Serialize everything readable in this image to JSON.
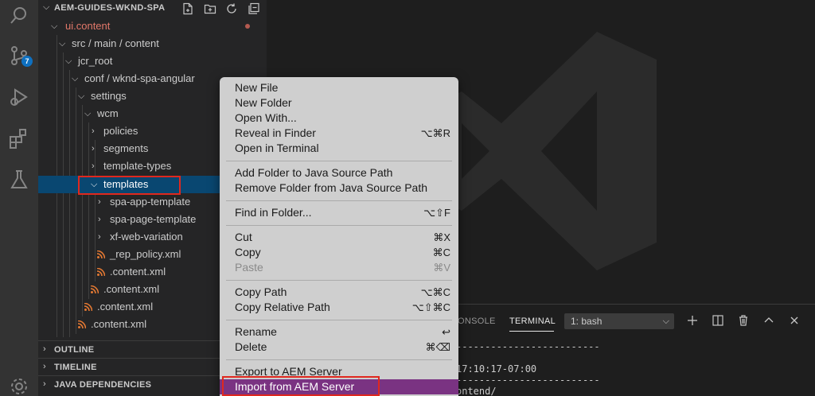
{
  "activity_bar": {
    "icons": [
      "explorer-icon",
      "source-control-icon",
      "run-debug-icon",
      "extensions-icon",
      "testing-icon",
      "settings-gear-icon"
    ],
    "scm_badge": "7"
  },
  "explorer": {
    "title": "AEM-GUIDES-WKND-SPA",
    "actions": [
      "new-file-icon",
      "new-folder-icon",
      "refresh-icon",
      "collapse-all-icon"
    ],
    "tree": {
      "ui_content": "ui.content",
      "src_path": "src / main / content",
      "jcr_root": "jcr_root",
      "conf_path": "conf / wknd-spa-angular",
      "settings": "settings",
      "wcm": "wcm",
      "policies": "policies",
      "segments": "segments",
      "template_types": "template-types",
      "templates": "templates",
      "spa_app_template": "spa-app-template",
      "spa_page_template": "spa-page-template",
      "xf_web_variation": "xf-web-variation",
      "rep_policy": "_rep_policy.xml",
      "content_xml_1": ".content.xml",
      "content_xml_2": ".content.xml",
      "content_xml_3": ".content.xml",
      "content_xml_4": ".content.xml"
    },
    "sections": {
      "outline": "OUTLINE",
      "timeline": "TIMELINE",
      "java_dependencies": "JAVA DEPENDENCIES"
    }
  },
  "panel": {
    "tab_console": "ONSOLE",
    "tab_terminal": "TERMINAL",
    "terminal_select": "1: bash",
    "lines": [
      "-------------------------",
      "17:10:17-07:00",
      "-------------------------",
      "ontend/"
    ]
  },
  "context_menu": {
    "new_file": "New File",
    "new_folder": "New Folder",
    "open_with": "Open With...",
    "reveal_in_finder": "Reveal in Finder",
    "reveal_in_finder_shortcut": "⌥⌘R",
    "open_in_terminal": "Open in Terminal",
    "add_folder_java": "Add Folder to Java Source Path",
    "remove_folder_java": "Remove Folder from Java Source Path",
    "find_in_folder": "Find in Folder...",
    "find_in_folder_shortcut": "⌥⇧F",
    "cut": "Cut",
    "cut_shortcut": "⌘X",
    "copy": "Copy",
    "copy_shortcut": "⌘C",
    "paste": "Paste",
    "paste_shortcut": "⌘V",
    "copy_path": "Copy Path",
    "copy_path_shortcut": "⌥⌘C",
    "copy_relative_path": "Copy Relative Path",
    "copy_relative_path_shortcut": "⌥⇧⌘C",
    "rename": "Rename",
    "rename_shortcut": "↩",
    "delete": "Delete",
    "delete_shortcut": "⌘⌫",
    "export_aem": "Export to AEM Server",
    "import_aem": "Import from AEM Server"
  },
  "colors": {
    "selection": "#094771",
    "menu_highlight": "#7a3382",
    "annotation_box": "#e0281e",
    "modified_text": "#e2786a"
  }
}
